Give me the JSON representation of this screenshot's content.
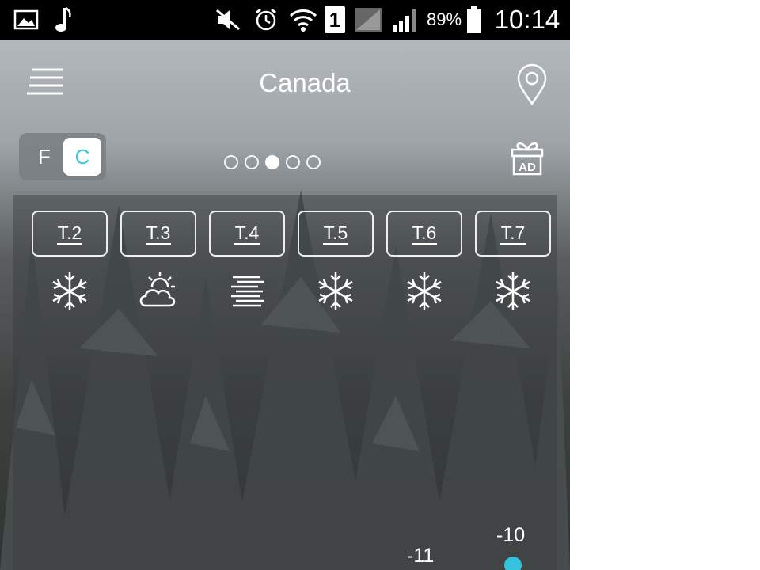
{
  "status_bar": {
    "icons": [
      "picture-icon",
      "music-note-icon",
      "mute-icon",
      "alarm-icon",
      "wifi-icon",
      "sim-1-icon",
      "signal-icon",
      "signal-icon",
      "battery-icon"
    ],
    "sim_label": "1",
    "battery_percent": "89%",
    "battery_level": 0.89,
    "time": "10:14"
  },
  "app_bar": {
    "title": "Canada",
    "menu_icon": "menu-icon",
    "location_icon": "location-pin-icon"
  },
  "unit_toggle": {
    "f_label": "F",
    "c_label": "C",
    "selected": "C",
    "accent_color": "#3fc6db"
  },
  "pager": {
    "total": 5,
    "active_index": 2
  },
  "ad_button": {
    "label": "AD",
    "icon": "gift-icon"
  },
  "forecast": {
    "days": [
      {
        "label": "T.2",
        "icon": "snow-icon"
      },
      {
        "label": "T.3",
        "icon": "partly-cloudy-icon"
      },
      {
        "label": "T.4",
        "icon": "fog-icon"
      },
      {
        "label": "T.5",
        "icon": "snow-icon"
      },
      {
        "label": "T.6",
        "icon": "snow-icon"
      },
      {
        "label": "T.7",
        "icon": "snow-icon"
      }
    ],
    "temps": [
      {
        "value": "-11"
      },
      {
        "value": "-10"
      }
    ],
    "line_color": "#36c2dc"
  }
}
